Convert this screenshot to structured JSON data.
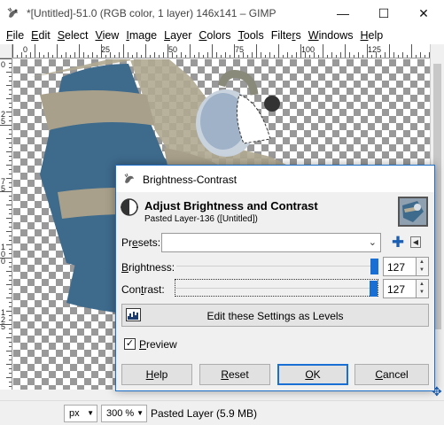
{
  "window": {
    "title": "*[Untitled]-51.0 (RGB color, 1 layer) 146x141 – GIMP",
    "minimize": "—",
    "maximize": "☐",
    "close": "✕",
    "app_icon": "gimp-icon"
  },
  "menubar": {
    "items": [
      {
        "pre": "",
        "key": "F",
        "post": "ile"
      },
      {
        "pre": "",
        "key": "E",
        "post": "dit"
      },
      {
        "pre": "",
        "key": "S",
        "post": "elect"
      },
      {
        "pre": "",
        "key": "V",
        "post": "iew"
      },
      {
        "pre": "",
        "key": "I",
        "post": "mage"
      },
      {
        "pre": "",
        "key": "L",
        "post": "ayer"
      },
      {
        "pre": "",
        "key": "C",
        "post": "olors"
      },
      {
        "pre": "",
        "key": "T",
        "post": "ools"
      },
      {
        "pre": "Filte",
        "key": "r",
        "post": "s"
      },
      {
        "pre": "",
        "key": "W",
        "post": "indows"
      },
      {
        "pre": "",
        "key": "H",
        "post": "elp"
      }
    ]
  },
  "rulers": {
    "h_labels": [
      "0",
      "25",
      "50",
      "75",
      "100",
      "125"
    ],
    "v_labels": [
      "0",
      "2",
      "5",
      "7",
      "5",
      "1",
      "0",
      "0",
      "1",
      "2",
      "5"
    ]
  },
  "statusbar": {
    "unit": "px",
    "zoom": "300 %",
    "status": "Pasted Layer (5.9 MB)"
  },
  "dialog": {
    "title": "Brightness-Contrast",
    "heading": "Adjust Brightness and Contrast",
    "subtitle": "Pasted Layer-136 ([Untitled])",
    "presets": {
      "pre": "Pr",
      "key": "e",
      "post": "sets:",
      "value": ""
    },
    "brightness": {
      "pre": "",
      "key": "B",
      "post": "rightness:",
      "value": "127",
      "level": 1.0
    },
    "contrast": {
      "pre": "Con",
      "key": "t",
      "post": "rast:",
      "value": "127",
      "level": 1.0
    },
    "levels_button": "Edit these Settings as Levels",
    "preview": {
      "pre": "",
      "key": "P",
      "post": "review",
      "checked": true
    },
    "buttons": {
      "help": {
        "pre": "",
        "key": "H",
        "post": "elp"
      },
      "reset": {
        "pre": "",
        "key": "R",
        "post": "eset"
      },
      "ok": {
        "pre": "",
        "key": "O",
        "post": "K"
      },
      "cancel": {
        "pre": "",
        "key": "C",
        "post": "ancel"
      }
    }
  },
  "colors": {
    "accent": "#1a6fd4",
    "layer_blue": "#3e6a8c",
    "layer_tan": "#a8a08a"
  }
}
